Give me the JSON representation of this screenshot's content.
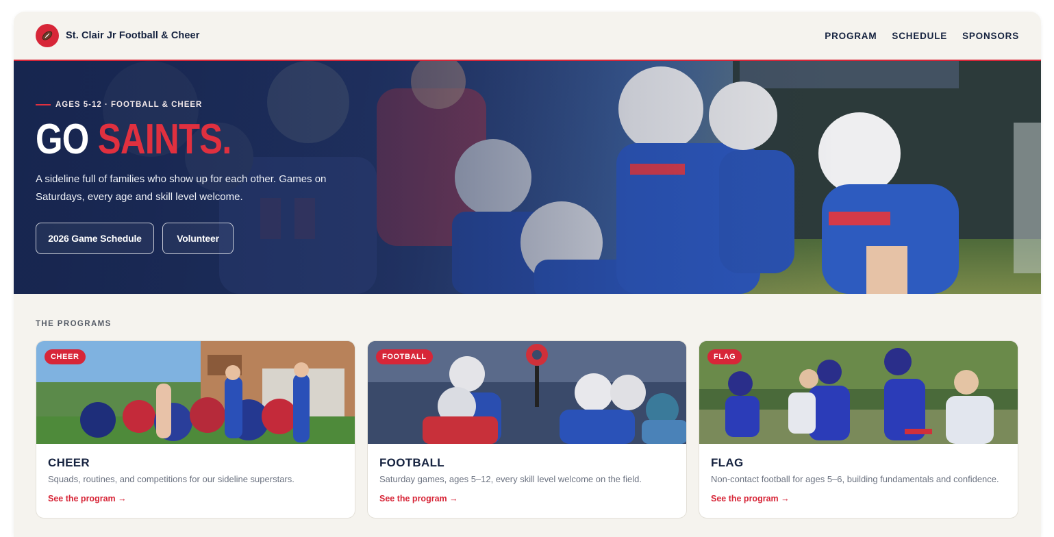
{
  "brand": {
    "name": "St. Clair Jr Football & Cheer",
    "logo_icon": "football-icon"
  },
  "nav": {
    "links": [
      "PROGRAM",
      "SCHEDULE",
      "SPONSORS"
    ]
  },
  "hero": {
    "eyebrow": "AGES 5-12 · FOOTBALL & CHEER",
    "headline_1": "GO",
    "headline_2": "SAINTS.",
    "lead": "A sideline full of families who show up for each other. Games on Saturdays, every age and skill level welcome.",
    "buttons": [
      "2026 Game Schedule",
      "Volunteer"
    ]
  },
  "programs": {
    "label": "THE PROGRAMS",
    "cards": [
      {
        "tag": "CHEER",
        "title": "CHEER",
        "desc": "Squads, routines, and competitions for our sideline superstars.",
        "link": "See the program →"
      },
      {
        "tag": "FOOTBALL",
        "title": "FOOTBALL",
        "desc": "Saturday games, ages 5–12, every skill level welcome on the field.",
        "link": "See the program →"
      },
      {
        "tag": "FLAG",
        "title": "FLAG",
        "desc": "Non-contact football for ages 5–6, building fundamentals and confidence.",
        "link": "See the program →"
      }
    ]
  },
  "colors": {
    "accent": "#d72638",
    "navy": "#15223f",
    "background": "#f5f3ee"
  }
}
